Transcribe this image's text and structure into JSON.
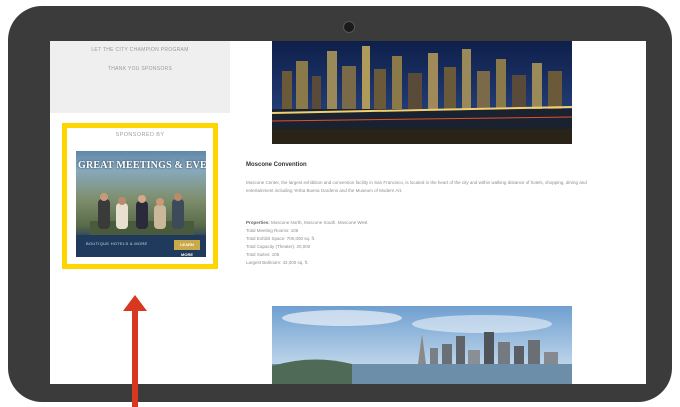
{
  "sidebar": {
    "links": [
      "LET THE CITY CHAMPION PROGRAM",
      "THANK YOU SPONSORS"
    ]
  },
  "sponsor": {
    "label": "SPONSORED BY",
    "ad_title": "GREAT MEETINGS & EVENTS",
    "ad_logo": "BOUTIQUE HOTELS & MORE",
    "ad_cta": "LEARN MORE"
  },
  "main": {
    "heading": "Moscone Convention",
    "paragraph1_line1": "Moscone Center, the largest exhibition and convention facility in San Francisco, is located in the heart of the city and within walking distance of hotels, shopping, dining and",
    "paragraph1_line2": "entertainment including Yerba Buena Gardens and the Museum of Modern Art.",
    "properties_label": "Properties:",
    "properties_value": "Moscone North, Moscone South, Moscone West",
    "stats": [
      "Total Meeting Rooms: 106",
      "Total Exhibit Space: 700,000 sq. ft.",
      "Total Capacity (Theater): 20,000",
      "Total Suites: 106",
      "Largest Ballroom: 42,000 sq. ft."
    ]
  },
  "colors": {
    "tablet_frame": "#3b3b3b",
    "highlight_border": "#ffd500",
    "arrow": "#d7381f"
  }
}
